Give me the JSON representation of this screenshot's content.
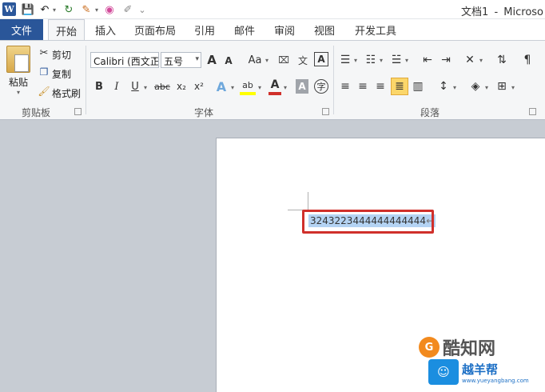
{
  "titlebar": {
    "app_icon_letter": "W",
    "doc_title": "文档1",
    "separator": "-",
    "app_name": "Microso"
  },
  "tabs": {
    "file": "文件",
    "items": [
      "开始",
      "插入",
      "页面布局",
      "引用",
      "邮件",
      "审阅",
      "视图",
      "开发工具"
    ],
    "active": "开始"
  },
  "clipboard": {
    "paste": "粘贴",
    "cut": "剪切",
    "copy": "复制",
    "format_painter": "格式刷",
    "group_label": "剪贴板"
  },
  "font": {
    "font_name": "Calibri (西文正文)",
    "font_size": "五号",
    "grow": "A",
    "shrink": "A",
    "change_case": "Aa",
    "bold": "B",
    "italic": "I",
    "underline": "U",
    "strikethrough": "abc",
    "subscript": "x₂",
    "superscript": "x²",
    "group_label": "字体"
  },
  "paragraph": {
    "group_label": "段落"
  },
  "document": {
    "text": "3243223444444444444",
    "para_mark": "↵"
  },
  "watermarks": {
    "site1_name": "酷知网",
    "site2_name": "越羊帮",
    "site2_url": "www.yueyangbang.com"
  },
  "colors": {
    "file_tab": "#2a5699",
    "selection": "#b4d3f3",
    "highlight_box": "#d0302b",
    "font_color_bar": "#d0302b",
    "highlight_color_bar": "#ffff00"
  }
}
